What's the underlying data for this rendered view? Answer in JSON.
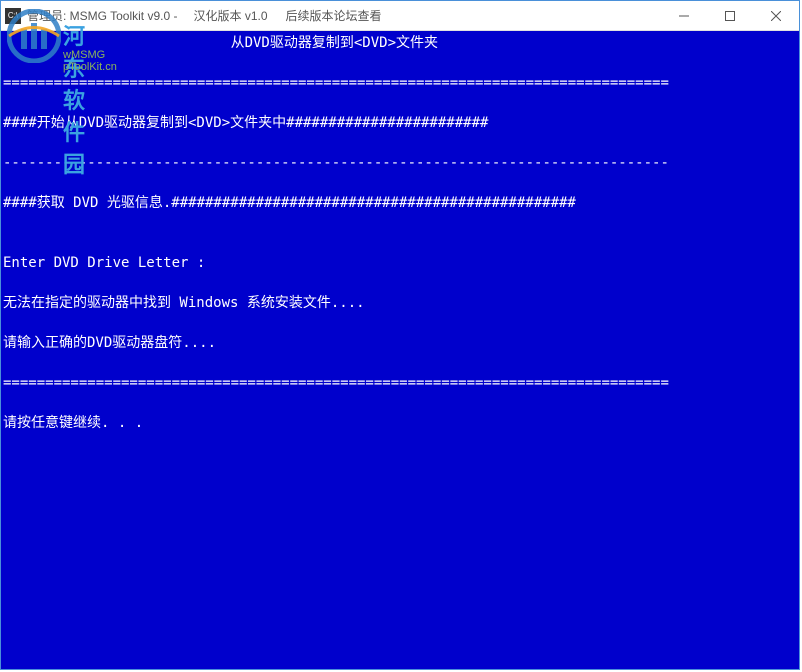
{
  "titlebar": {
    "icon_label": "cmd-icon",
    "title": "管理员:  MSMG Toolkit v9.0 -",
    "menu": [
      "汉化版本 v1.0",
      "后续版本论坛查看"
    ]
  },
  "watermark": {
    "text": "河东软件园",
    "sub": "wMSMG pToolKit.cn"
  },
  "console": {
    "lines": [
      "                           从DVD驱动器复制到<DVD>文件夹",
      "",
      "===============================================================================",
      "",
      "####开始从DVD驱动器复制到<DVD>文件夹中########################",
      "",
      "-------------------------------------------------------------------------------",
      "",
      "####获取 DVD 光驱信息.################################################",
      "",
      "",
      "Enter DVD Drive Letter :",
      "",
      "无法在指定的驱动器中找到 Windows 系统安装文件....",
      "",
      "请输入正确的DVD驱动器盘符....",
      "",
      "===============================================================================",
      "",
      "请按任意键继续. . ."
    ]
  }
}
